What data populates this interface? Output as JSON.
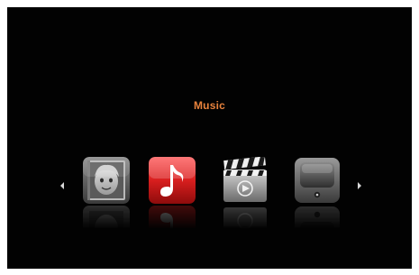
{
  "menu": {
    "selected_label": "Music",
    "accent_color": "#e8823c",
    "items": [
      {
        "icon": "photo-icon",
        "selected": false
      },
      {
        "icon": "music-note-icon",
        "selected": true
      },
      {
        "icon": "clapperboard-icon",
        "selected": false
      },
      {
        "icon": "tv-icon",
        "selected": false
      }
    ],
    "nav": {
      "left_icon": "arrow-left-icon",
      "right_icon": "arrow-right-icon"
    }
  }
}
